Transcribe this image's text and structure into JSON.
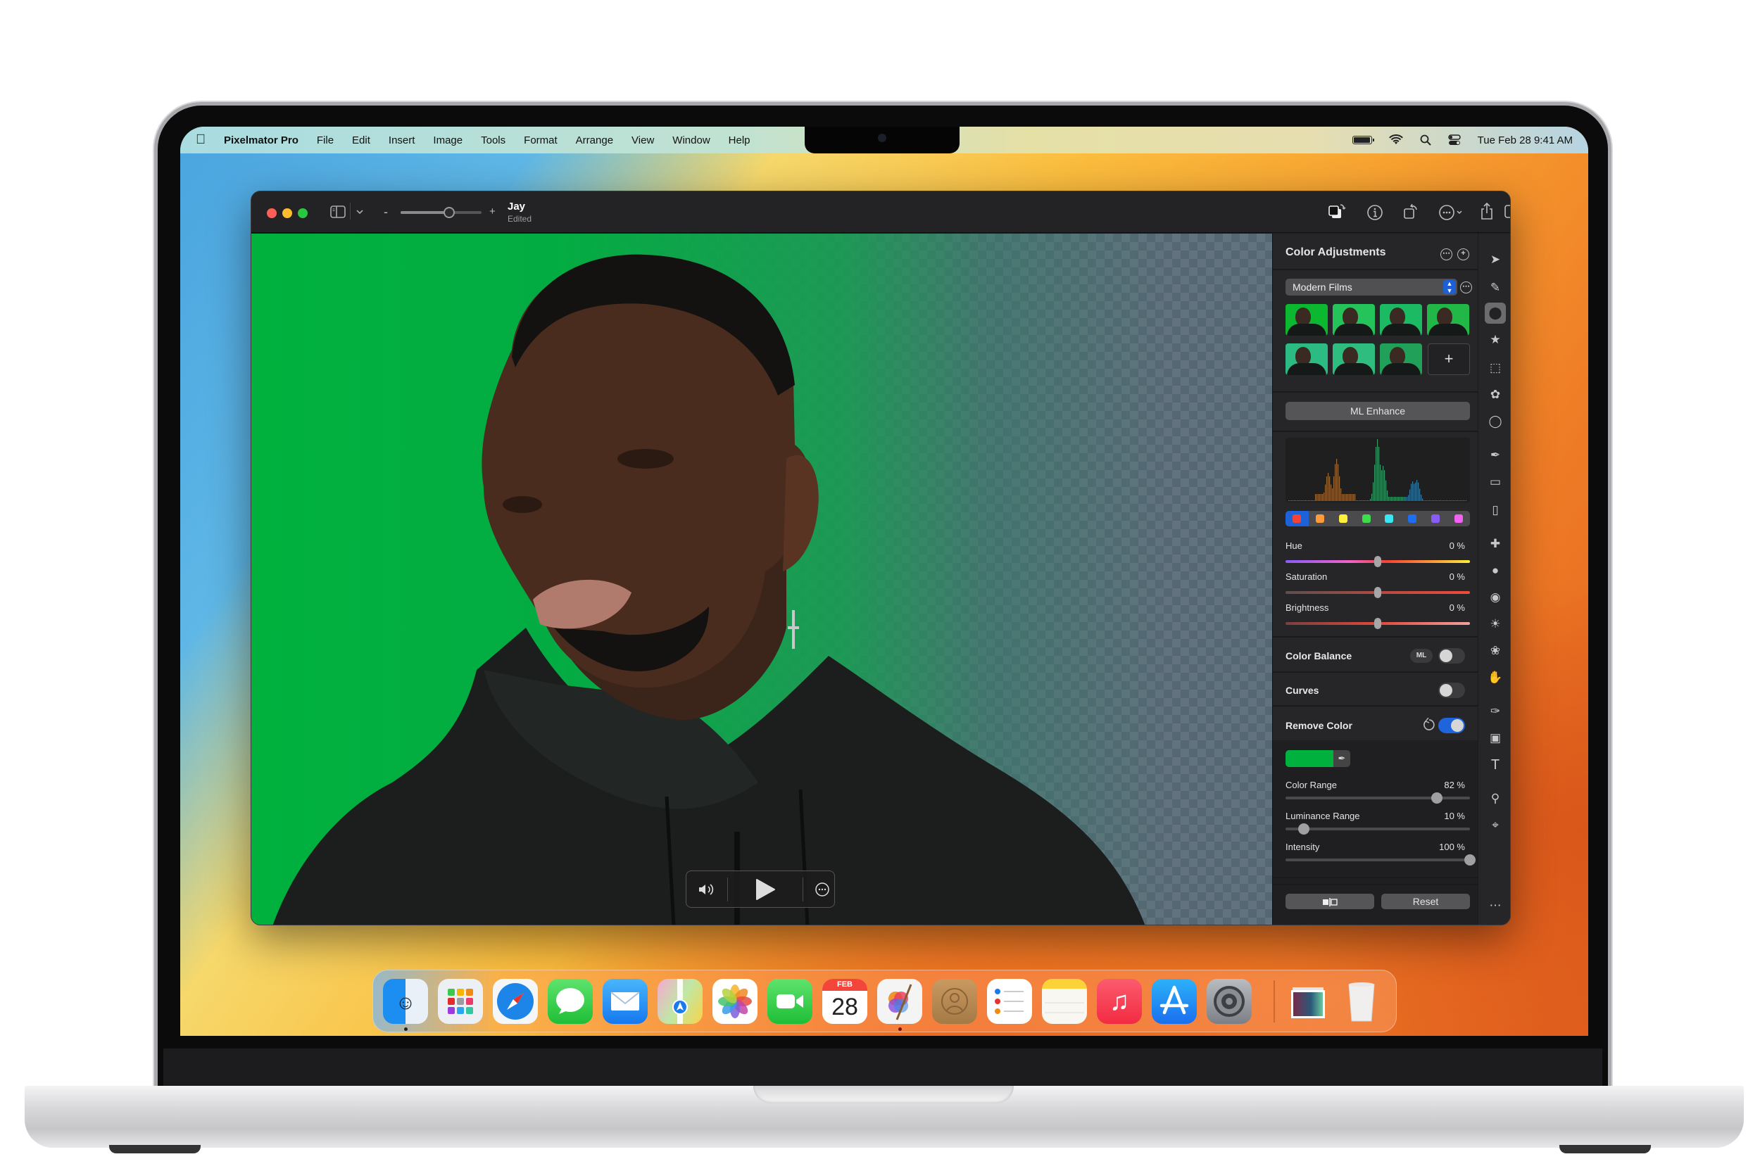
{
  "menubar": {
    "app_name": "Pixelmator Pro",
    "menus": [
      "File",
      "Edit",
      "Insert",
      "Image",
      "Tools",
      "Format",
      "Arrange",
      "View",
      "Window",
      "Help"
    ],
    "status_icons": [
      "battery-icon",
      "wifi-icon",
      "spotlight-search-icon",
      "control-center-icon"
    ],
    "datetime": "Tue Feb 28  9:41 AM"
  },
  "window": {
    "title": "Jay",
    "subtitle": "Edited",
    "zoom_slider_value": 0.6,
    "zoom_minus": "-",
    "zoom_plus": "+",
    "toolbar_icons": [
      "arrange-icon",
      "info-icon",
      "rotate-icon",
      "more-icon",
      "share-icon",
      "sidebar-icon"
    ]
  },
  "canvas": {
    "remove_color_hex": "#00B13E",
    "player": {
      "volume_icon": "speaker-icon",
      "play_icon": "play-icon",
      "more_icon": "more-icon"
    }
  },
  "panel": {
    "title": "Color Adjustments",
    "preset_selected": "Modern Films",
    "preset_thumb_colors": [
      "#0cb82f",
      "#24c45a",
      "#1cbb63",
      "#22b847",
      "#2dbb84",
      "#2fbd7f",
      "#21a05a"
    ],
    "ml_enhance_label": "ML Enhance",
    "histogram_colors": [
      "#9a6a3a",
      "#3a9a6a",
      "#3a7aa0"
    ],
    "swatch_colors": [
      "#f44336",
      "#ff9a3c",
      "#ffee3a",
      "#3ddc4a",
      "#39e6f2",
      "#1e6ef2",
      "#8a5cf6",
      "#f062f2"
    ],
    "selected_swatch": 0,
    "sliders": [
      {
        "label": "Hue",
        "value_text": "0 %",
        "value": 0
      },
      {
        "label": "Saturation",
        "value_text": "0 %",
        "value": 0
      },
      {
        "label": "Brightness",
        "value_text": "0 %",
        "value": 0
      }
    ],
    "color_balance": {
      "label": "Color Balance",
      "badge": "ML",
      "enabled": false
    },
    "curves": {
      "label": "Curves",
      "enabled": false
    },
    "remove_color": {
      "label": "Remove Color",
      "enabled": true,
      "color": "#00B13E",
      "sliders": [
        {
          "label": "Color Range",
          "value_text": "82 %",
          "value": 82
        },
        {
          "label": "Luminance Range",
          "value_text": "10 %",
          "value": 10
        },
        {
          "label": "Intensity",
          "value_text": "100 %",
          "value": 100
        }
      ]
    },
    "compare_icon": "before-after-icon",
    "reset_label": "Reset"
  },
  "tools": [
    "arrow-icon",
    "style-brush-icon",
    "color-adjust-icon",
    "effects-icon",
    "rect-select-icon",
    "lasso-select-icon",
    "quick-select-icon",
    "paint-brush-icon",
    "paint-bucket-icon",
    "eraser-icon",
    "repair-icon",
    "clone-icon",
    "blur-icon",
    "light-icon",
    "color-icon",
    "warp-icon",
    "pen-icon",
    "shape-icon",
    "type-icon",
    "zoom-icon",
    "crop-icon",
    "more-tools-icon"
  ],
  "dock": {
    "apps": [
      {
        "name": "Finder",
        "running": true
      },
      {
        "name": "Launchpad",
        "running": false
      },
      {
        "name": "Safari",
        "running": false
      },
      {
        "name": "Messages",
        "running": false
      },
      {
        "name": "Mail",
        "running": false
      },
      {
        "name": "Maps",
        "running": false
      },
      {
        "name": "Photos",
        "running": false
      },
      {
        "name": "FaceTime",
        "running": false
      },
      {
        "name": "Calendar",
        "running": false,
        "month": "FEB",
        "day": "28"
      },
      {
        "name": "Pixelmator Pro",
        "running": true
      },
      {
        "name": "Contacts",
        "running": false
      },
      {
        "name": "Reminders",
        "running": false
      },
      {
        "name": "Notes",
        "running": false
      },
      {
        "name": "Music",
        "running": false
      },
      {
        "name": "App Store",
        "running": false
      },
      {
        "name": "System Settings",
        "running": false
      }
    ],
    "extras": [
      "Downloads stack",
      "Trash"
    ]
  }
}
